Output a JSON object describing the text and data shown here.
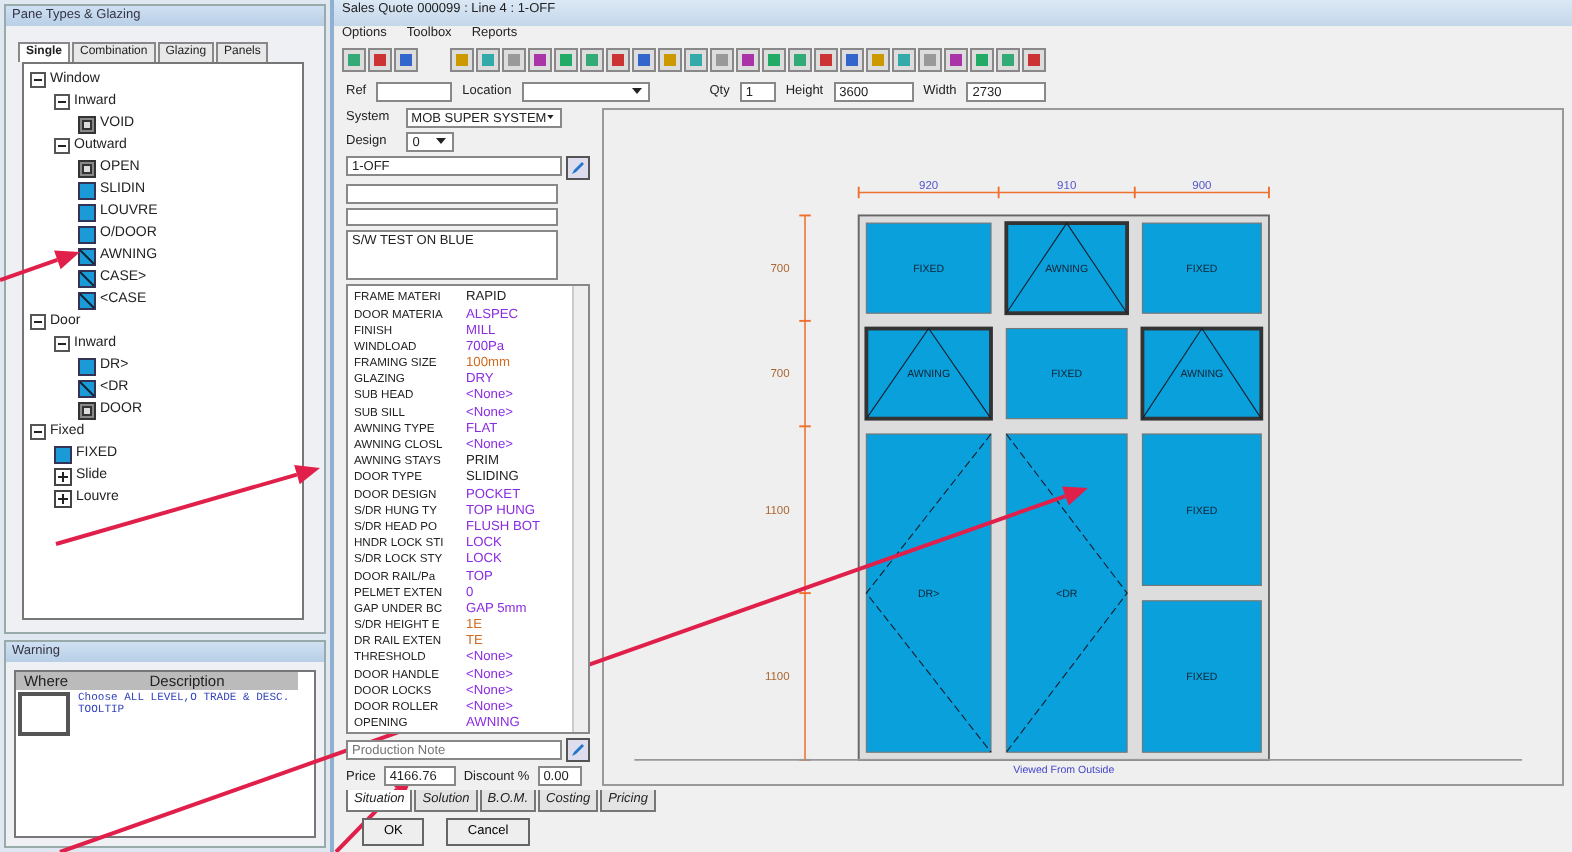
{
  "tree_panel": {
    "title": "Pane Types & Glazing",
    "tabs": [
      {
        "label": "Single",
        "selected": true
      },
      {
        "label": "Combination",
        "selected": false
      },
      {
        "label": "Glazing",
        "selected": false
      },
      {
        "label": "Panels",
        "selected": false
      }
    ],
    "tree": [
      {
        "label": "Window",
        "expanded": true,
        "children": [
          {
            "label": "Inward",
            "expanded": true,
            "children": [
              {
                "label": "VOID",
                "kind": "void"
              }
            ]
          },
          {
            "label": "Outward",
            "expanded": true,
            "children": [
              {
                "label": "OPEN",
                "kind": "void"
              },
              {
                "label": "SLIDIN",
                "kind": "fixed"
              },
              {
                "label": "LOUVRE",
                "kind": "fixed"
              },
              {
                "label": "O/DOOR",
                "kind": "fixed"
              },
              {
                "label": "AWNING",
                "kind": "sash"
              },
              {
                "label": "CASE>",
                "kind": "sash"
              },
              {
                "label": "<CASE",
                "kind": "sash"
              }
            ]
          }
        ]
      },
      {
        "label": "Door",
        "expanded": true,
        "children": [
          {
            "label": "Inward",
            "expanded": true,
            "children": [
              {
                "label": "DR>",
                "kind": "fixed"
              },
              {
                "label": "<DR",
                "kind": "sash"
              },
              {
                "label": "DOOR",
                "kind": "void"
              }
            ]
          }
        ]
      },
      {
        "label": "Fixed",
        "expanded": true,
        "children": [
          {
            "label": "FIXED",
            "kind": "fixed"
          },
          {
            "label": "Slide",
            "kind": "plus"
          },
          {
            "label": "Louvre",
            "kind": "plus"
          }
        ]
      }
    ]
  },
  "warning_panel": {
    "title": "Warning",
    "columns": [
      "Where",
      "Description"
    ],
    "rows": [
      {
        "description": "Choose ALL LEVEL,O TRADE & DESC. TOOLTIP"
      }
    ]
  },
  "main_window": {
    "title": "Sales Quote 000099 : Line 4 : 1-OFF",
    "menu": [
      "Options",
      "Toolbox",
      "Reports"
    ],
    "fields": [
      {
        "label": "Ref"
      },
      {
        "label": "Location",
        "kind": "dropdown"
      },
      {
        "label": "Qty",
        "value": "1"
      },
      {
        "label": "Height",
        "value": "3600"
      },
      {
        "label": "Width",
        "value": "2730"
      }
    ],
    "system": {
      "label": "System",
      "value": "MOB SUPER SYSTEM"
    },
    "design": {
      "label": "Design",
      "value": "0"
    },
    "line_name": "1-OFF",
    "notes": "S/W TEST ON BLUE",
    "properties": [
      {
        "name": "FRAME MATERI",
        "value": "RAPID",
        "color": "#222222"
      },
      {
        "name": "DOOR MATERIA",
        "value": "ALSPEC",
        "color": "#8a2be2"
      },
      {
        "name": "FINISH",
        "value": "MILL",
        "color": "#8a2be2"
      },
      {
        "name": "WINDLOAD",
        "value": "700Pa",
        "color": "#8a2be2"
      },
      {
        "name": "FRAMING SIZE",
        "value": "100mm",
        "color": "#d2691e"
      },
      {
        "name": "GLAZING",
        "value": "DRY",
        "color": "#8a2be2"
      },
      {
        "name": "SUB HEAD",
        "value": "<None>",
        "color": "#8a2be2"
      },
      {
        "name": "SUB SILL",
        "value": "<None>",
        "color": "#8a2be2"
      },
      {
        "name": "AWNING TYPE",
        "value": "FLAT",
        "color": "#8a2be2"
      },
      {
        "name": "AWNING CLOSL",
        "value": "<None>",
        "color": "#8a2be2"
      },
      {
        "name": "AWNING STAYS",
        "value": "PRIM",
        "color": "#222222"
      },
      {
        "name": "DOOR TYPE",
        "value": "SLIDING",
        "color": "#222222"
      },
      {
        "name": "DOOR DESIGN",
        "value": "POCKET",
        "color": "#8a2be2"
      },
      {
        "name": "S/DR HUNG TY",
        "value": "TOP HUNG",
        "color": "#8a2be2"
      },
      {
        "name": "S/DR HEAD PO",
        "value": "FLUSH BOT",
        "color": "#8a2be2"
      },
      {
        "name": "HNDR LOCK STI",
        "value": "LOCK",
        "color": "#8a2be2"
      },
      {
        "name": "S/DR LOCK STY",
        "value": "LOCK",
        "color": "#8a2be2"
      },
      {
        "name": "DOOR RAIL/Pa",
        "value": "TOP",
        "color": "#8a2be2"
      },
      {
        "name": "PELMET EXTEN",
        "value": "0",
        "color": "#8a2be2"
      },
      {
        "name": "GAP UNDER BC",
        "value": "GAP 5mm",
        "color": "#8a2be2"
      },
      {
        "name": "S/DR HEIGHT E",
        "value": "1E",
        "color": "#d2691e"
      },
      {
        "name": "DR RAIL EXTEN",
        "value": "TE",
        "color": "#d2691e"
      },
      {
        "name": "THRESHOLD",
        "value": "<None>",
        "color": "#8a2be2"
      },
      {
        "name": "DOOR HANDLE",
        "value": "<None>",
        "color": "#8a2be2"
      },
      {
        "name": "DOOR LOCKS",
        "value": "<None>",
        "color": "#8a2be2"
      },
      {
        "name": "DOOR ROLLER",
        "value": "<None>",
        "color": "#8a2be2"
      },
      {
        "name": "OPENING",
        "value": "AWNING",
        "color": "#8a2be2"
      }
    ],
    "production_note": {
      "placeholder": "Production Note"
    },
    "price": {
      "label": "Price",
      "value": "4166.76"
    },
    "discount": {
      "label": "Discount %",
      "value": "0.00"
    },
    "tabs": [
      {
        "label": "Situation",
        "selected": true
      },
      {
        "label": "Solution",
        "selected": false
      },
      {
        "label": "B.O.M.",
        "selected": false
      },
      {
        "label": "Costing",
        "selected": false
      },
      {
        "label": "Pricing",
        "selected": false
      }
    ],
    "buttons": [
      "OK",
      "Cancel"
    ],
    "elevation": {
      "widths": [
        "920",
        "910",
        "900"
      ],
      "heights": [
        "700",
        "700",
        "1100",
        "1100"
      ],
      "columns": [
        {
          "panes": [
            {
              "kind": "fixed",
              "label": "FIXED"
            },
            {
              "kind": "awning",
              "label": "AWNING"
            },
            {
              "kind": "door_right",
              "label": "DR>"
            }
          ]
        },
        {
          "panes": [
            {
              "kind": "awning",
              "label": "AWNING"
            },
            {
              "kind": "fixed",
              "label": "FIXED"
            },
            {
              "kind": "door_left",
              "label": "<DR"
            }
          ]
        },
        {
          "panes": [
            {
              "kind": "fixed",
              "label": "FIXED"
            },
            {
              "kind": "awning",
              "label": "AWNING"
            },
            {
              "kind": "fixed",
              "label": "FIXED"
            },
            {
              "kind": "fixed",
              "label": "FIXED"
            }
          ]
        }
      ],
      "caption": "Viewed From Outside"
    }
  }
}
